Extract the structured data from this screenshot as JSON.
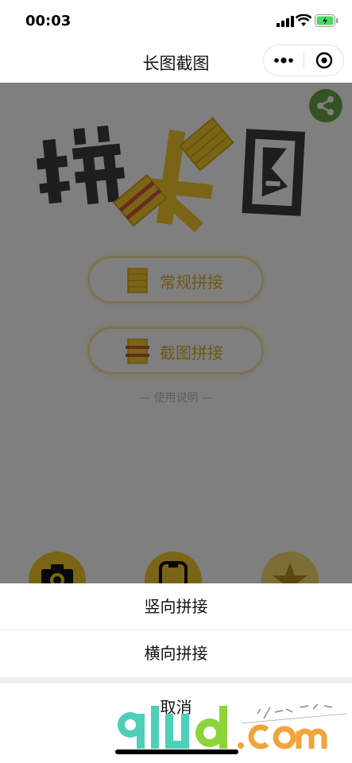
{
  "status_bar": {
    "time": "00:03"
  },
  "nav": {
    "title": "长图截图"
  },
  "main": {
    "buttons": [
      {
        "label": "常规拼接"
      },
      {
        "label": "截图拼接"
      }
    ],
    "help_text": "— 使用说明 —"
  },
  "action_sheet": {
    "options": [
      "竖向拼接",
      "横向拼接"
    ],
    "cancel": "取消"
  },
  "colors": {
    "accent_yellow": "#f4c92b",
    "share_green": "#6aa640",
    "overlay": "rgba(0,0,0,0.5)"
  },
  "icons": [
    "signal-icon",
    "wifi-icon",
    "battery-icon",
    "more-icon",
    "close-target-icon",
    "share-icon",
    "camera-icon",
    "phone-icon",
    "star-icon"
  ]
}
